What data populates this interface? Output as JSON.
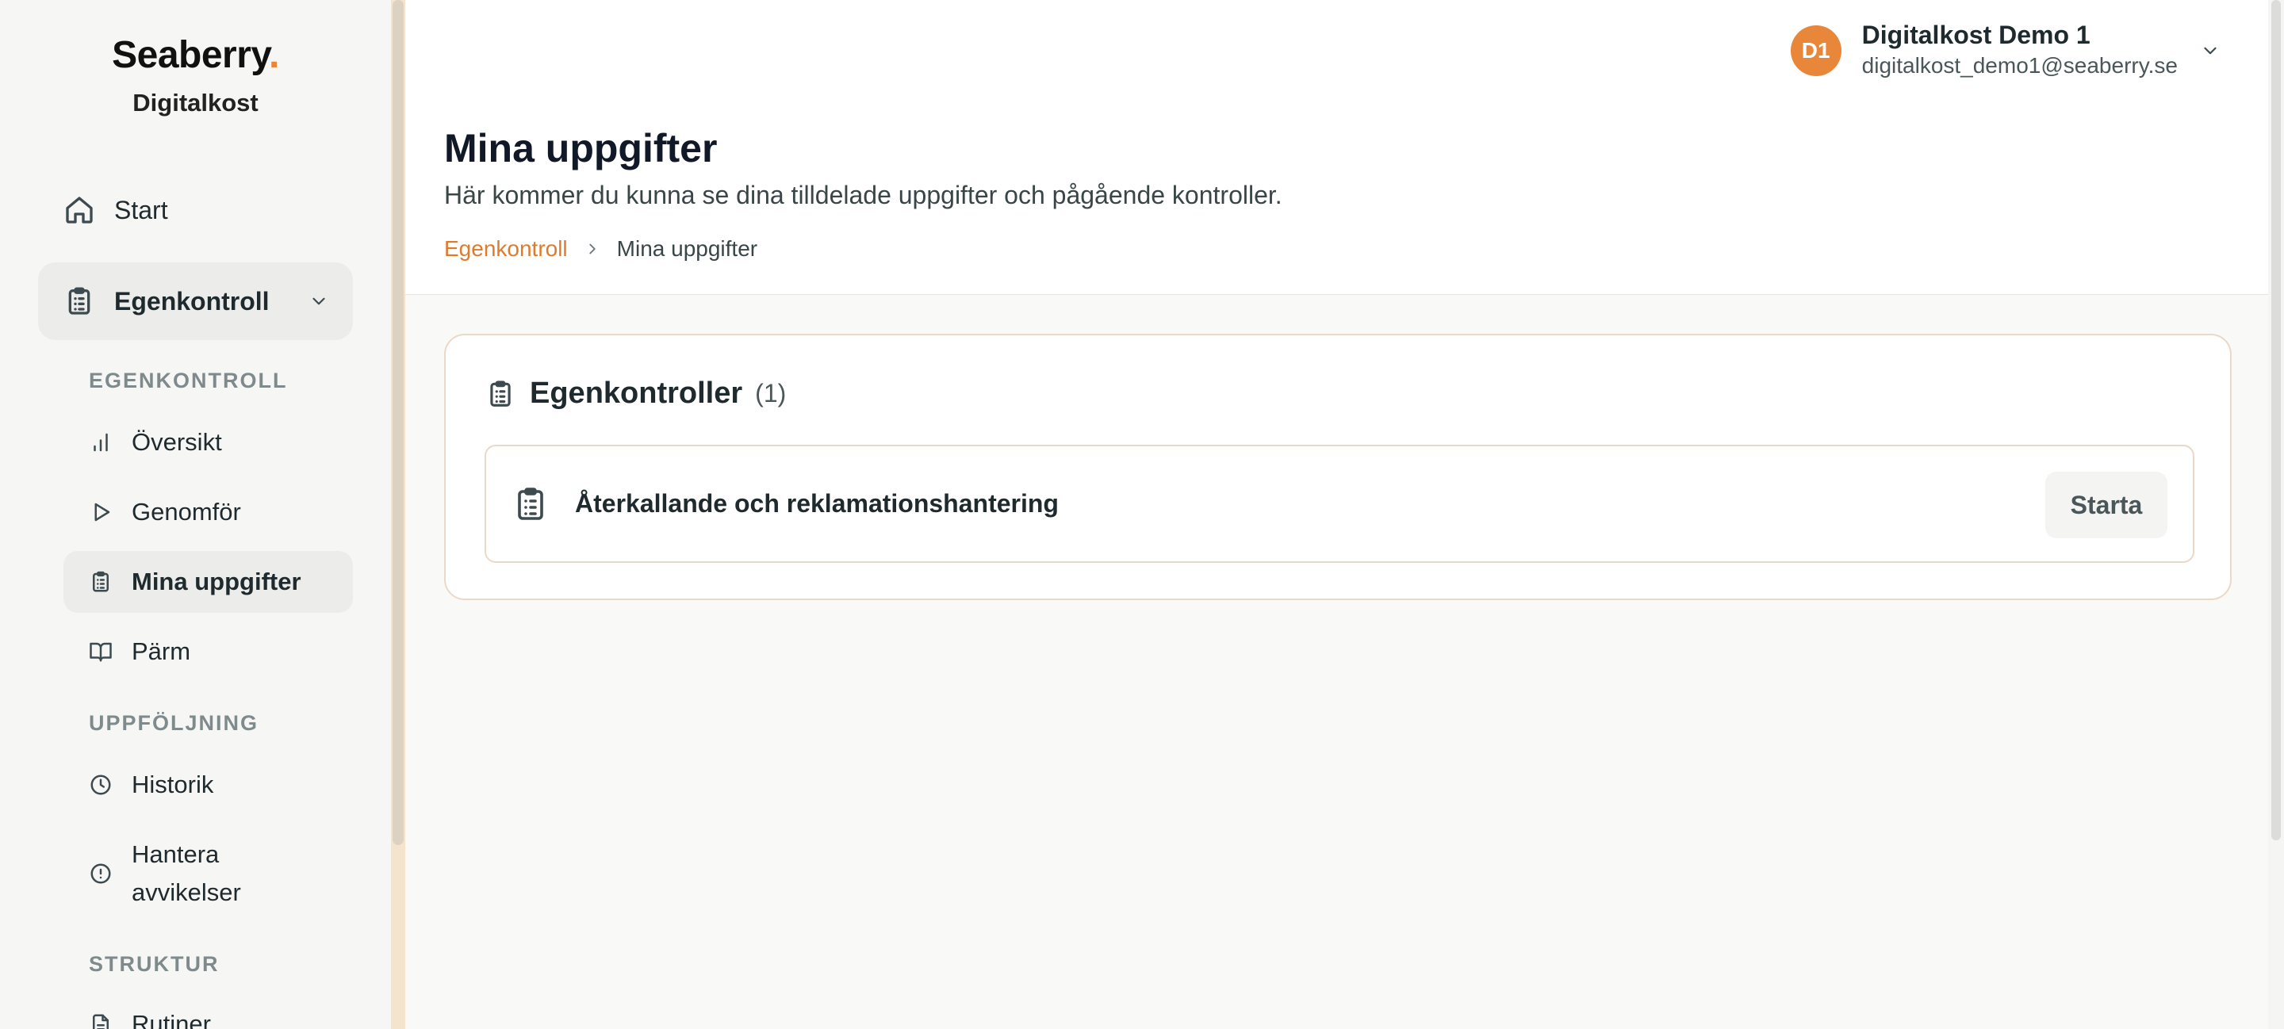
{
  "sidebar": {
    "logo_text": "Seaberry",
    "logo_dot": ".",
    "brand": "Digitalkost",
    "start_label": "Start",
    "egenkontroll_label": "Egenkontroll",
    "sections": {
      "egenkontroll": "EGENKONTROLL",
      "uppfoljning": "UPPFÖLJNING",
      "struktur": "STRUKTUR"
    },
    "items": {
      "oversikt": "Översikt",
      "genomfor": "Genomför",
      "mina_uppgifter": "Mina uppgifter",
      "parm": "Pärm",
      "historik": "Historik",
      "hantera_1": "Hantera",
      "hantera_2": "avvikelser",
      "rutiner": "Rutiner"
    }
  },
  "header": {
    "avatar_initials": "D1",
    "user_name": "Digitalkost Demo 1",
    "user_email": "digitalkost_demo1@seaberry.se"
  },
  "page": {
    "title": "Mina uppgifter",
    "subtitle": "Här kommer du kunna se dina tilldelade uppgifter och pågående kontroller.",
    "breadcrumb": {
      "parent": "Egenkontroll",
      "current": "Mina uppgifter"
    }
  },
  "card": {
    "title": "Egenkontroller",
    "count": "(1)",
    "tasks": [
      {
        "name": "Återkallande och reklamationshantering",
        "action": "Starta"
      }
    ]
  },
  "colors": {
    "accent": "#e8863a",
    "border": "#ecd8c6",
    "sidebar_bg": "#f6f6f5"
  }
}
